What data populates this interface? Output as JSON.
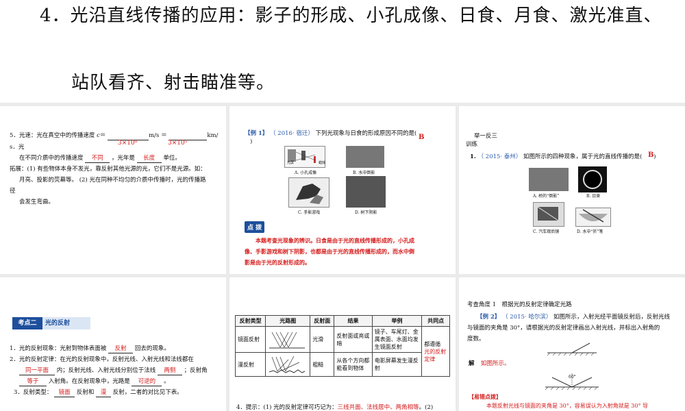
{
  "top": {
    "line1": "4．光沿直线传播的应用：影子的形成、小孔成像、日食、月食、激光准直、",
    "line2": "站队看齐、射击瞄准等。"
  },
  "p1": {
    "l1a": "5．光速：光在真空中的传播速度",
    "l1c": "c",
    "l1eq": "＝",
    "l1unit1": "m/s ＝",
    "l1unit2": "km/",
    "ans1": "3×10⁸",
    "ans2": "3×10⁵",
    "l2": "s．光",
    "l3a": "在不同介质中的传播速度",
    "l3ans1": "不同",
    "l3b": "，光年是",
    "l3ans2": "长度",
    "l3c": "单位。",
    "l4": "拓展：(1) 有些物体本身不发光，靠反射其他光源的光，它们不是光源。如：",
    "l5": "月亮、投影的荧幕等。 (2) 光在同种不均匀的介质中传播时，光的传播路",
    "l6": "径",
    "l7": "会发生弯曲。"
  },
  "p2": {
    "ex_label": "【例 1】",
    "ex_src": "（ 2016· 宿迁）",
    "ex_text": "下列光现象与日食的形成原因不同的是(",
    "ex_close": ")",
    "ans": "B",
    "capA": "A. 小孔成像",
    "capB": "B. 水中倒影",
    "capC": "C. 手影游戏",
    "capD": "D. 树下阴影",
    "pin_a": "光屏",
    "pin_b": "蜡烛",
    "badge": "点 拨",
    "n1": "本题考查光现象的辨识。日食是由于光的直线传播形成的，小孔成",
    "n2": "像、手影游戏和树下阴影，也都是由于光的直线传播形成的，而水中倒",
    "n3": "影是由于光的反射形成的。"
  },
  "p3": {
    "h1": "举一反三",
    "h2": "训练",
    "q_num": "1.",
    "q_src": "（ 2015· 泰州）",
    "q_text": "如图所示的四种现象，属于光的直线传播的是(",
    "q_close": ")",
    "ans": "B",
    "capA": "A. 桥的“倒影”",
    "capB": "B. 日食",
    "capC": "C. 汽车观后镜",
    "capD": "D. 水中“折”笔"
  },
  "p4": {
    "kd_a": "考点二",
    "kd_b": "光的反射",
    "l1a": "1．光的反射现象：光射到物体表面被",
    "l1ans": "反射",
    "l1b": "回去的现象。",
    "l2": "2．光的反射定律：在光的反射现象中，反射光线、入射光线和法线都在",
    "l3ans1": "同一平面",
    "l3a": "内；反射光线、入射光线分别位于法线",
    "l3ans2": "两侧",
    "l3b": "；反射角",
    "l4ans1": "等于",
    "l4a": "入射角。在反射现象中，光路是",
    "l4ans2": "可逆的",
    "l4b": "。",
    "l5a": "3．反射类型：",
    "l5ans1": "镜面",
    "l5b": "反射和",
    "l5ans2": "漫",
    "l5c": "反射，二者的对比见下表。"
  },
  "p5": {
    "headers": [
      "反射类型",
      "光路图",
      "反射面",
      "结果",
      "举例",
      "共同点"
    ],
    "row1": {
      "type": "镜面反射",
      "surface": "光滑",
      "result": "反射面或亮或暗",
      "example": "镜子、车尾灯、金属表面、水面均发生镜面反射"
    },
    "row2": {
      "type": "漫反射",
      "surface": "粗糙",
      "result": "从各个方向都能看到物体",
      "example": "电影屏幕发生漫反射"
    },
    "common_a": "都遵循",
    "common_b": "光的反射定律",
    "tip_a": "4．提示：(1) 光的反射定律可巧记为：",
    "tip_b": "三线共面、法线居中、两角相等",
    "tip_c": "。(2)"
  },
  "p6": {
    "h": "考查角度 1　根据光的反射定律确定光路",
    "ex_label": "【例 2】",
    "ex_src": "（ 2015· 哈尔滨）",
    "l1": "如图所示，入射光经平面镜反射后，反射光线",
    "l2": "与镜面的夹角是 30°，请根据光的反射定律画出入射光线，并标出入射角的",
    "l3": "度数。",
    "jie": "解",
    "jie_ans": "如图所示。",
    "angle": "60°",
    "yc": "【易错点拨】",
    "yc_text": "本题反射光线与镜面的夹角是 30°，容易误认为入射角就是 30° 导"
  }
}
